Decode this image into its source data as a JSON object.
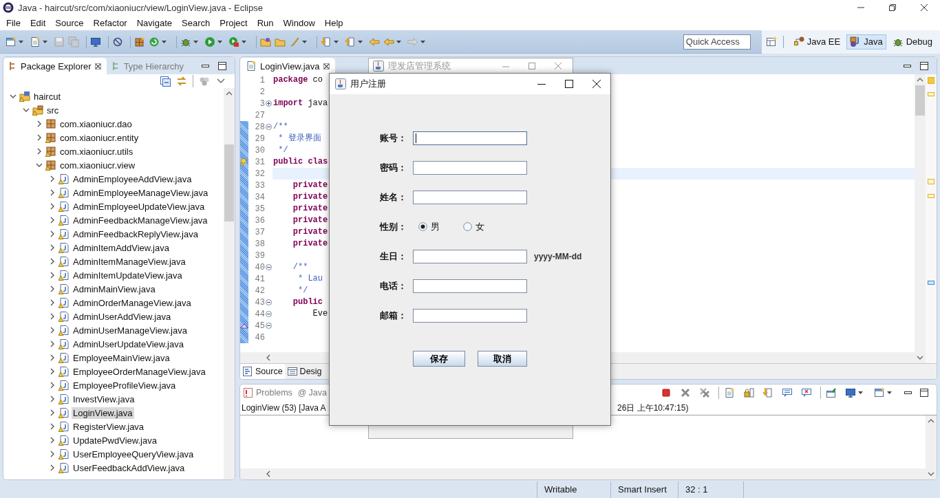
{
  "window": {
    "title": "Java - haircut/src/com/xiaoniucr/view/LoginView.java - Eclipse"
  },
  "menu": [
    "File",
    "Edit",
    "Source",
    "Refactor",
    "Navigate",
    "Search",
    "Project",
    "Run",
    "Window",
    "Help"
  ],
  "quick_access": {
    "placeholder": "Quick Access"
  },
  "perspectives": [
    {
      "label": "Java EE",
      "kind": "javaee",
      "selected": false
    },
    {
      "label": "Java",
      "kind": "java",
      "selected": true
    },
    {
      "label": "Debug",
      "kind": "debug",
      "selected": false
    }
  ],
  "explorer": {
    "tabs": [
      {
        "label": "Package Explorer",
        "selected": true
      },
      {
        "label": "Type Hierarchy",
        "selected": false
      }
    ],
    "tree": [
      {
        "label": "haircut",
        "kind": "project",
        "expanded": true,
        "selected": false,
        "warning": true,
        "children": [
          {
            "label": "src",
            "kind": "folder",
            "expanded": true,
            "selected": false,
            "warning": true,
            "children": [
              {
                "label": "com.xiaoniucr.dao",
                "kind": "package",
                "expanded": false,
                "selected": false,
                "warning": false
              },
              {
                "label": "com.xiaoniucr.entity",
                "kind": "package",
                "expanded": false,
                "selected": false,
                "warning": true
              },
              {
                "label": "com.xiaoniucr.utils",
                "kind": "package",
                "expanded": false,
                "selected": false,
                "warning": true
              },
              {
                "label": "com.xiaoniucr.view",
                "kind": "package",
                "expanded": true,
                "selected": false,
                "warning": true,
                "children": [
                  {
                    "label": "AdminEmployeeAddView.java",
                    "kind": "file",
                    "expanded": false,
                    "selected": false,
                    "warning": true
                  },
                  {
                    "label": "AdminEmployeeManageView.java",
                    "kind": "file",
                    "expanded": false,
                    "selected": false,
                    "warning": true
                  },
                  {
                    "label": "AdminEmployeeUpdateView.java",
                    "kind": "file",
                    "expanded": false,
                    "selected": false,
                    "warning": true
                  },
                  {
                    "label": "AdminFeedbackManageView.java",
                    "kind": "file",
                    "expanded": false,
                    "selected": false,
                    "warning": true
                  },
                  {
                    "label": "AdminFeedbackReplyView.java",
                    "kind": "file",
                    "expanded": false,
                    "selected": false,
                    "warning": true
                  },
                  {
                    "label": "AdminItemAddView.java",
                    "kind": "file",
                    "expanded": false,
                    "selected": false,
                    "warning": true
                  },
                  {
                    "label": "AdminItemManageView.java",
                    "kind": "file",
                    "expanded": false,
                    "selected": false,
                    "warning": true
                  },
                  {
                    "label": "AdminItemUpdateView.java",
                    "kind": "file",
                    "expanded": false,
                    "selected": false,
                    "warning": true
                  },
                  {
                    "label": "AdminMainView.java",
                    "kind": "file",
                    "expanded": false,
                    "selected": false,
                    "warning": true
                  },
                  {
                    "label": "AdminOrderManageView.java",
                    "kind": "file",
                    "expanded": false,
                    "selected": false,
                    "warning": true
                  },
                  {
                    "label": "AdminUserAddView.java",
                    "kind": "file",
                    "expanded": false,
                    "selected": false,
                    "warning": true
                  },
                  {
                    "label": "AdminUserManageView.java",
                    "kind": "file",
                    "expanded": false,
                    "selected": false,
                    "warning": true
                  },
                  {
                    "label": "AdminUserUpdateView.java",
                    "kind": "file",
                    "expanded": false,
                    "selected": false,
                    "warning": true
                  },
                  {
                    "label": "EmployeeMainView.java",
                    "kind": "file",
                    "expanded": false,
                    "selected": false,
                    "warning": true
                  },
                  {
                    "label": "EmployeeOrderManageView.java",
                    "kind": "file",
                    "expanded": false,
                    "selected": false,
                    "warning": true
                  },
                  {
                    "label": "EmployeeProfileView.java",
                    "kind": "file",
                    "expanded": false,
                    "selected": false,
                    "warning": true
                  },
                  {
                    "label": "InvestView.java",
                    "kind": "file",
                    "expanded": false,
                    "selected": false,
                    "warning": true
                  },
                  {
                    "label": "LoginView.java",
                    "kind": "file",
                    "expanded": false,
                    "selected": true,
                    "warning": true
                  },
                  {
                    "label": "RegisterView.java",
                    "kind": "file",
                    "expanded": false,
                    "selected": false,
                    "warning": true
                  },
                  {
                    "label": "UpdatePwdView.java",
                    "kind": "file",
                    "expanded": false,
                    "selected": false,
                    "warning": true
                  },
                  {
                    "label": "UserEmployeeQueryView.java",
                    "kind": "file",
                    "expanded": false,
                    "selected": false,
                    "warning": true
                  },
                  {
                    "label": "UserFeedbackAddView.java",
                    "kind": "file",
                    "expanded": false,
                    "selected": false,
                    "warning": true
                  }
                ]
              }
            ]
          }
        ]
      }
    ]
  },
  "editor": {
    "tabs": [
      {
        "label": "LoginView.java",
        "selected": true
      }
    ],
    "lines": [
      {
        "number": "1",
        "tokens": [
          {
            "text": "package",
            "kind": "keyword"
          },
          {
            "text": " co",
            "kind": "plain"
          }
        ],
        "changed": false,
        "current": false
      },
      {
        "number": "2",
        "changed": false,
        "current": false
      },
      {
        "number": "3",
        "folded": true,
        "tokens": [
          {
            "text": "import",
            "kind": "keyword"
          },
          {
            "text": " java",
            "kind": "plain"
          }
        ],
        "changed": false,
        "current": false
      },
      {
        "number": "27",
        "changed": false,
        "current": false
      },
      {
        "number": "28",
        "folded": false,
        "tokens": [
          {
            "text": "/**",
            "kind": "javadoc"
          }
        ],
        "changed": true,
        "current": false
      },
      {
        "number": "29",
        "tokens": [
          {
            "text": " * 登录界面",
            "kind": "javadoc"
          }
        ],
        "changed": true,
        "current": false
      },
      {
        "number": "30",
        "tokens": [
          {
            "text": " */",
            "kind": "javadoc"
          }
        ],
        "changed": true,
        "current": false
      },
      {
        "number": "31",
        "warning": true,
        "tokens": [
          {
            "text": "public clas",
            "kind": "keyword"
          }
        ],
        "changed": true,
        "current": false
      },
      {
        "number": "32",
        "changed": true,
        "current": true
      },
      {
        "number": "33",
        "tokens": [
          {
            "text": "    private",
            "kind": "keyword"
          }
        ],
        "changed": true,
        "current": false
      },
      {
        "number": "34",
        "tokens": [
          {
            "text": "    private",
            "kind": "keyword"
          }
        ],
        "changed": true,
        "current": false
      },
      {
        "number": "35",
        "tokens": [
          {
            "text": "    private",
            "kind": "keyword"
          }
        ],
        "changed": true,
        "current": false
      },
      {
        "number": "36",
        "tokens": [
          {
            "text": "    private",
            "kind": "keyword"
          }
        ],
        "changed": true,
        "current": false
      },
      {
        "number": "37",
        "tokens": [
          {
            "text": "    private",
            "kind": "keyword"
          }
        ],
        "changed": true,
        "current": false
      },
      {
        "number": "38",
        "tokens": [
          {
            "text": "    private",
            "kind": "keyword"
          }
        ],
        "changed": true,
        "current": false
      },
      {
        "number": "39",
        "changed": true,
        "current": false
      },
      {
        "number": "40",
        "folded": false,
        "tokens": [
          {
            "text": "    /**",
            "kind": "javadoc"
          }
        ],
        "changed": true,
        "current": false
      },
      {
        "number": "41",
        "tokens": [
          {
            "text": "     * Lau",
            "kind": "javadoc"
          }
        ],
        "changed": true,
        "current": false
      },
      {
        "number": "42",
        "tokens": [
          {
            "text": "     */",
            "kind": "javadoc"
          }
        ],
        "changed": true,
        "current": false
      },
      {
        "number": "43",
        "folded": false,
        "tokens": [
          {
            "text": "    public",
            "kind": "keyword"
          }
        ],
        "changed": true,
        "current": false
      },
      {
        "number": "44",
        "folded": false,
        "tokens": [
          {
            "text": "        Eve",
            "kind": "plain"
          }
        ],
        "changed": true,
        "current": false
      },
      {
        "number": "45",
        "folded": false,
        "annotation": true,
        "changed": true,
        "current": false
      },
      {
        "number": "46",
        "changed": true,
        "current": false
      }
    ],
    "bottom_tabs": [
      {
        "label": "Source",
        "kind": "source",
        "selected": true
      },
      {
        "label": "Desig",
        "kind": "design",
        "selected": false
      }
    ]
  },
  "console": {
    "tabs": [
      {
        "label": "Problems",
        "kind": "problems",
        "selected": false
      },
      {
        "label": "Java",
        "kind": "javadoc",
        "icon": "@",
        "selected": false
      }
    ],
    "launch_left": "LoginView (53) [Java A",
    "launch_right": "26日 上午10:47:15)"
  },
  "status_bar": [
    "Writable",
    "Smart Insert",
    "32 : 1"
  ],
  "background_window": {
    "title": "理发店管理系统"
  },
  "dialog": {
    "title": "用户注册",
    "fields": [
      {
        "label": "账号：",
        "kind": "text",
        "focused": true
      },
      {
        "label": "密码：",
        "kind": "text",
        "focused": false
      },
      {
        "label": "姓名：",
        "kind": "text",
        "focused": false
      },
      {
        "label": "性别：",
        "kind": "radio",
        "options": [
          {
            "label": "男",
            "selected": true
          },
          {
            "label": "女",
            "selected": false
          }
        ]
      },
      {
        "label": "生日：",
        "kind": "text",
        "focused": false,
        "hint": "yyyy-MM-dd"
      },
      {
        "label": "电话：",
        "kind": "text",
        "focused": false
      },
      {
        "label": "邮箱：",
        "kind": "text",
        "focused": false
      }
    ],
    "buttons": [
      "保存",
      "取消"
    ]
  }
}
